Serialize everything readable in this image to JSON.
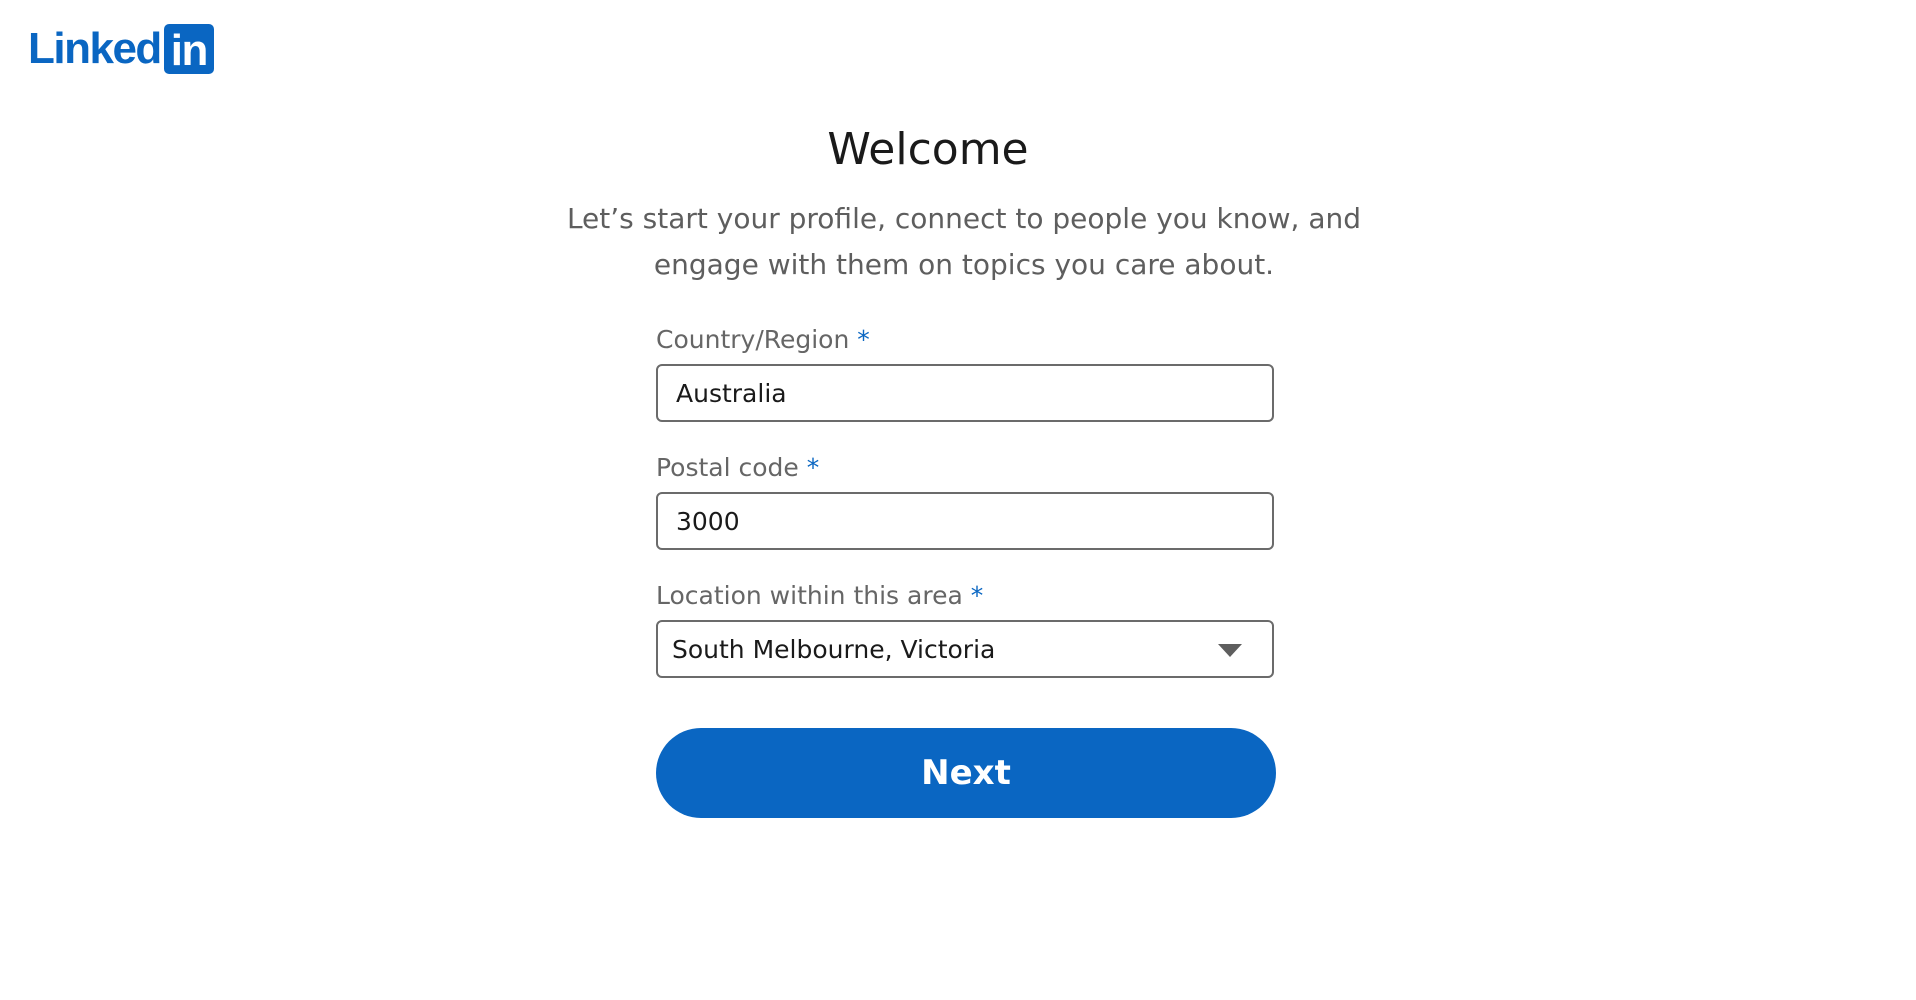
{
  "brand": {
    "logo_word": "Linked",
    "logo_box": "in",
    "color": "#0a66c2"
  },
  "header": {
    "title": "Welcome",
    "subtitle": "Let’s start your profile, connect to people you know, and engage with them on topics you care about."
  },
  "form": {
    "country": {
      "label": "Country/Region",
      "required_mark": "*",
      "value": "Australia"
    },
    "postal": {
      "label": "Postal code",
      "required_mark": "*",
      "value": "3000"
    },
    "location": {
      "label": "Location within this area",
      "required_mark": "*",
      "value": "South Melbourne, Victoria",
      "icon": "caret-down-icon"
    },
    "next_label": "Next"
  }
}
